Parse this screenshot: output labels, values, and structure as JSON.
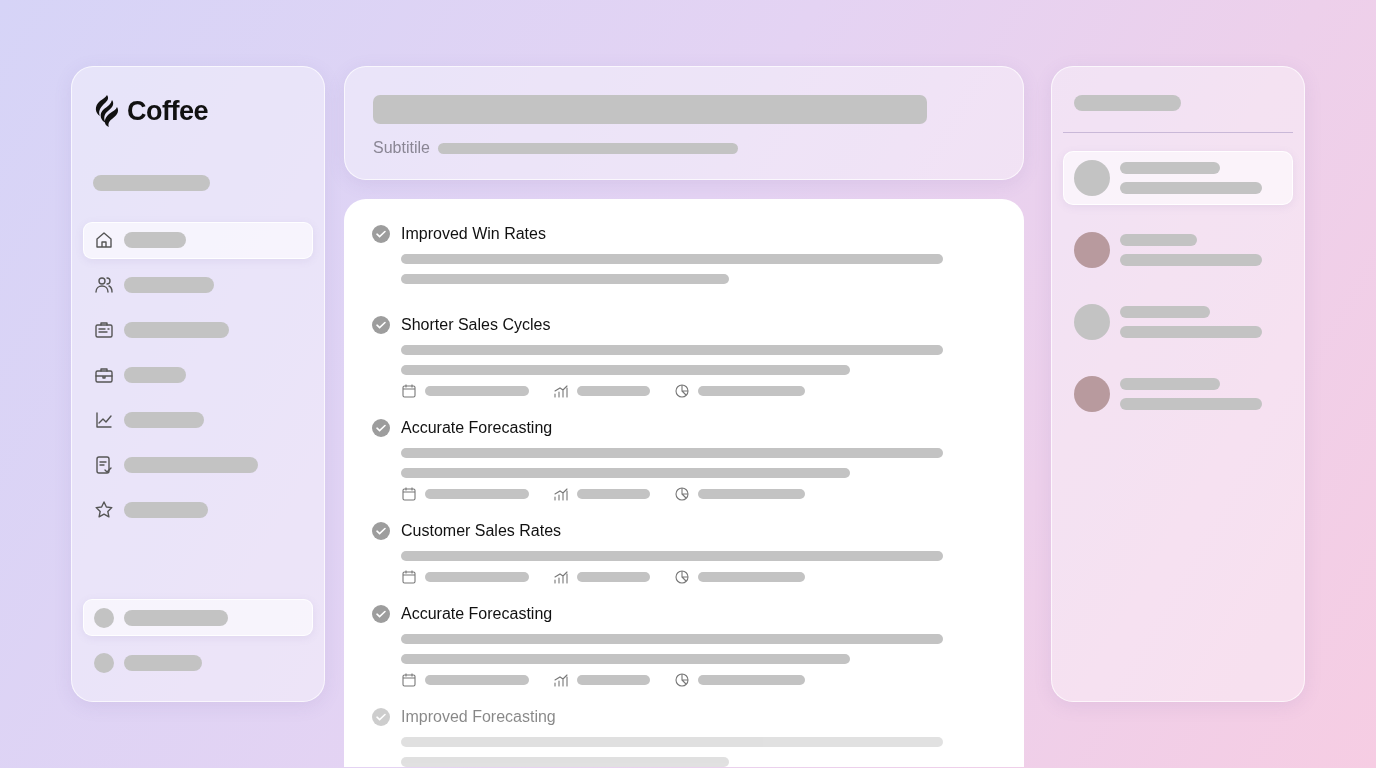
{
  "brand": {
    "name": "Coffee"
  },
  "sidebar": {
    "items": [
      {
        "kind": "home",
        "selected": true
      },
      {
        "kind": "users",
        "selected": false
      },
      {
        "kind": "clipboard",
        "selected": false
      },
      {
        "kind": "briefcase",
        "selected": false
      },
      {
        "kind": "chart",
        "selected": false
      },
      {
        "kind": "checklist",
        "selected": false
      },
      {
        "kind": "star",
        "selected": false
      }
    ],
    "accounts": [
      {
        "selected": true
      },
      {
        "selected": false
      }
    ]
  },
  "header": {
    "subtitle_label": "Subtitile"
  },
  "benefits": [
    {
      "title": "Improved Win Rates",
      "kind": "simple",
      "faded": false
    },
    {
      "title": "Shorter Sales Cycles",
      "kind": "detailed",
      "faded": false
    },
    {
      "title": "Accurate Forecasting",
      "kind": "detailed",
      "faded": false
    },
    {
      "title": "Customer Sales Rates",
      "kind": "compact",
      "faded": false
    },
    {
      "title": "Accurate Forecasting",
      "kind": "detailed",
      "faded": false
    },
    {
      "title": "Improved Forecasting",
      "kind": "simple",
      "faded": true
    }
  ],
  "contacts": [
    {
      "kind": "blank",
      "selected": true
    },
    {
      "kind": "photo",
      "selected": false
    },
    {
      "kind": "blank",
      "selected": false
    },
    {
      "kind": "photo",
      "selected": false
    }
  ]
}
